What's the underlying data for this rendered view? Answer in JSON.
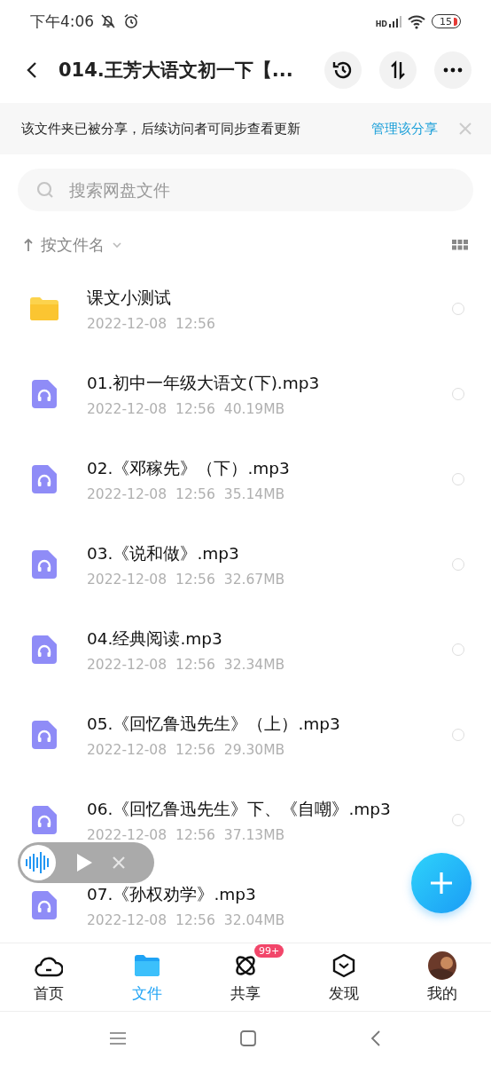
{
  "status_bar": {
    "time": "下午4:06",
    "network_label": "HD",
    "battery": "15"
  },
  "header": {
    "title": "014.王芳大语文初一下【..."
  },
  "banner": {
    "text": "该文件夹已被分享，后续访问者可同步查看更新",
    "link": "管理该分享"
  },
  "search": {
    "placeholder": "搜索网盘文件"
  },
  "sort": {
    "label": "按文件名"
  },
  "files": [
    {
      "kind": "folder",
      "name": "课文小测试",
      "date": "2022-12-08",
      "time": "12:56",
      "selected": false
    },
    {
      "kind": "audio",
      "name": "01.初中一年级大语文(下).mp3",
      "date": "2022-12-08",
      "time": "12:56",
      "size": "40.19MB",
      "selected": false
    },
    {
      "kind": "audio",
      "name": "02.《邓稼先》（下）.mp3",
      "date": "2022-12-08",
      "time": "12:56",
      "size": "35.14MB",
      "selected": false
    },
    {
      "kind": "audio",
      "name": "03.《说和做》.mp3",
      "date": "2022-12-08",
      "time": "12:56",
      "size": "32.67MB",
      "selected": false
    },
    {
      "kind": "audio",
      "name": "04.经典阅读.mp3",
      "date": "2022-12-08",
      "time": "12:56",
      "size": "32.34MB",
      "selected": false
    },
    {
      "kind": "audio",
      "name": "05.《回忆鲁迅先生》（上）.mp3",
      "date": "2022-12-08",
      "time": "12:56",
      "size": "29.30MB",
      "selected": false
    },
    {
      "kind": "audio",
      "name": "06.《回忆鲁迅先生》下、《自嘲》.mp3",
      "date": "2022-12-08",
      "time": "12:56",
      "size": "37.13MB",
      "selected": false
    },
    {
      "kind": "audio",
      "name": "07.《孙权劝学》.mp3",
      "date": "2022-12-08",
      "time": "12:56",
      "size": "32.04MB"
    }
  ],
  "nav": [
    {
      "kind": "home",
      "label": "首页",
      "selected": false
    },
    {
      "kind": "files",
      "label": "文件",
      "selected": true
    },
    {
      "kind": "share",
      "label": "共享",
      "selected": false,
      "badge": "99+"
    },
    {
      "kind": "discover",
      "label": "发现",
      "selected": false
    },
    {
      "kind": "me",
      "label": "我的",
      "selected": false
    }
  ]
}
